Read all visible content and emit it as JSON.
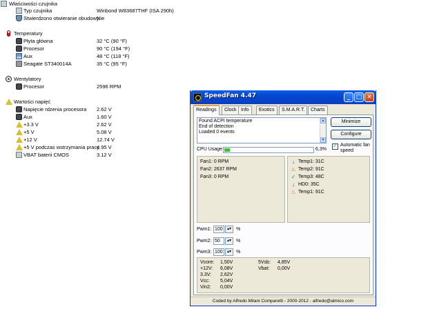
{
  "sensor_panel": {
    "sensor_props": {
      "header": "Właściwości czujnika",
      "rows": [
        {
          "label": "Typ czujnika",
          "value": "Winbond W83687THF  (ISA 290h)"
        },
        {
          "label": "Stwierdzono otwieranie obudowy",
          "value": "Nie"
        }
      ]
    },
    "temperatures": {
      "header": "Temperatury",
      "rows": [
        {
          "label": "Płyta główna",
          "value": "32 °C  (90 °F)"
        },
        {
          "label": "Procesor",
          "value": "90 °C  (194 °F)"
        },
        {
          "label": "Aux",
          "value": "48 °C  (118 °F)"
        },
        {
          "label": "Seagate ST340014A",
          "value": "35 °C  (95 °F)"
        }
      ]
    },
    "fans": {
      "header": "Wentylatory",
      "rows": [
        {
          "label": "Procesor",
          "value": "2596 RPM"
        }
      ]
    },
    "voltages": {
      "header": "Wartości napięć",
      "rows": [
        {
          "label": "Napięcie rdzenia procesora",
          "value": "2.62 V"
        },
        {
          "label": "Aux",
          "value": "1.60 V"
        },
        {
          "label": "+3.3 V",
          "value": "2.62 V"
        },
        {
          "label": "+5 V",
          "value": "5.08 V"
        },
        {
          "label": "+12 V",
          "value": "12.74 V"
        },
        {
          "label": "+5 V podczas wstrzymania pracy",
          "value": "4.95 V"
        },
        {
          "label": "VBAT baterii CMOS",
          "value": "3.12 V"
        }
      ]
    }
  },
  "speedfan": {
    "title": "SpeedFan 4.47",
    "minimize_glyph": "_",
    "maximize_glyph": "□",
    "close_glyph": "✕",
    "tabs": [
      "Readings",
      "Clock",
      "Info",
      "Exotics",
      "S.M.A.R.T.",
      "Charts"
    ],
    "active_tab": "Readings",
    "log_lines": [
      "Found ACPI temperature",
      "End of detection",
      "Loaded 0 events"
    ],
    "minimize_label": "Minimize",
    "configure_label": "Configure",
    "auto_fan_label": "Automatic fan speed",
    "auto_fan_checked": true,
    "cpu_usage_label": "CPU Usage",
    "cpu_usage_value": "6,3%",
    "cpu_usage_fraction": 0.063,
    "fans": [
      "Fan1: 0 RPM",
      "Fan2: 2637 RPM",
      "Fan3: 0 RPM"
    ],
    "temps": [
      {
        "icon": "arrow-down-icon",
        "text": "Temp1: 31C"
      },
      {
        "icon": "flame-icon",
        "text": "Temp2: 91C"
      },
      {
        "icon": "checkmark-icon",
        "text": "Temp3: 48C"
      },
      {
        "icon": "arrow-down-icon",
        "text": "HD0:   35C"
      },
      {
        "icon": "flame-icon",
        "text": "Temp1: 91C"
      }
    ],
    "pwm": [
      {
        "label": "Pwm1:",
        "value": "100",
        "unit": "%"
      },
      {
        "label": "Pwm2:",
        "value": "50",
        "unit": "%"
      },
      {
        "label": "Pwm3:",
        "value": "100",
        "unit": "%"
      }
    ],
    "voltages_left": [
      {
        "label": "Vcore:",
        "value": "1,50V"
      },
      {
        "label": "+12V:",
        "value": "6,08V"
      },
      {
        "label": "3.3V:",
        "value": "2,62V"
      },
      {
        "label": "Vcc:",
        "value": "5,04V"
      },
      {
        "label": "Vin2:",
        "value": "0,00V"
      }
    ],
    "voltages_right": [
      {
        "label": "5Vsb:",
        "value": "4,85V"
      },
      {
        "label": "Vbat:",
        "value": "0,00V"
      }
    ],
    "status": "Coded by Alfredo Milani Comparetti - 2000-2012 - alfredo@almico.com",
    "colors": {
      "title_bar": "#0448d0",
      "cpu_bar": "#3ac23a",
      "arrow_down": "#1a48d0",
      "flame": "#e05010",
      "check": "#20a020"
    }
  }
}
